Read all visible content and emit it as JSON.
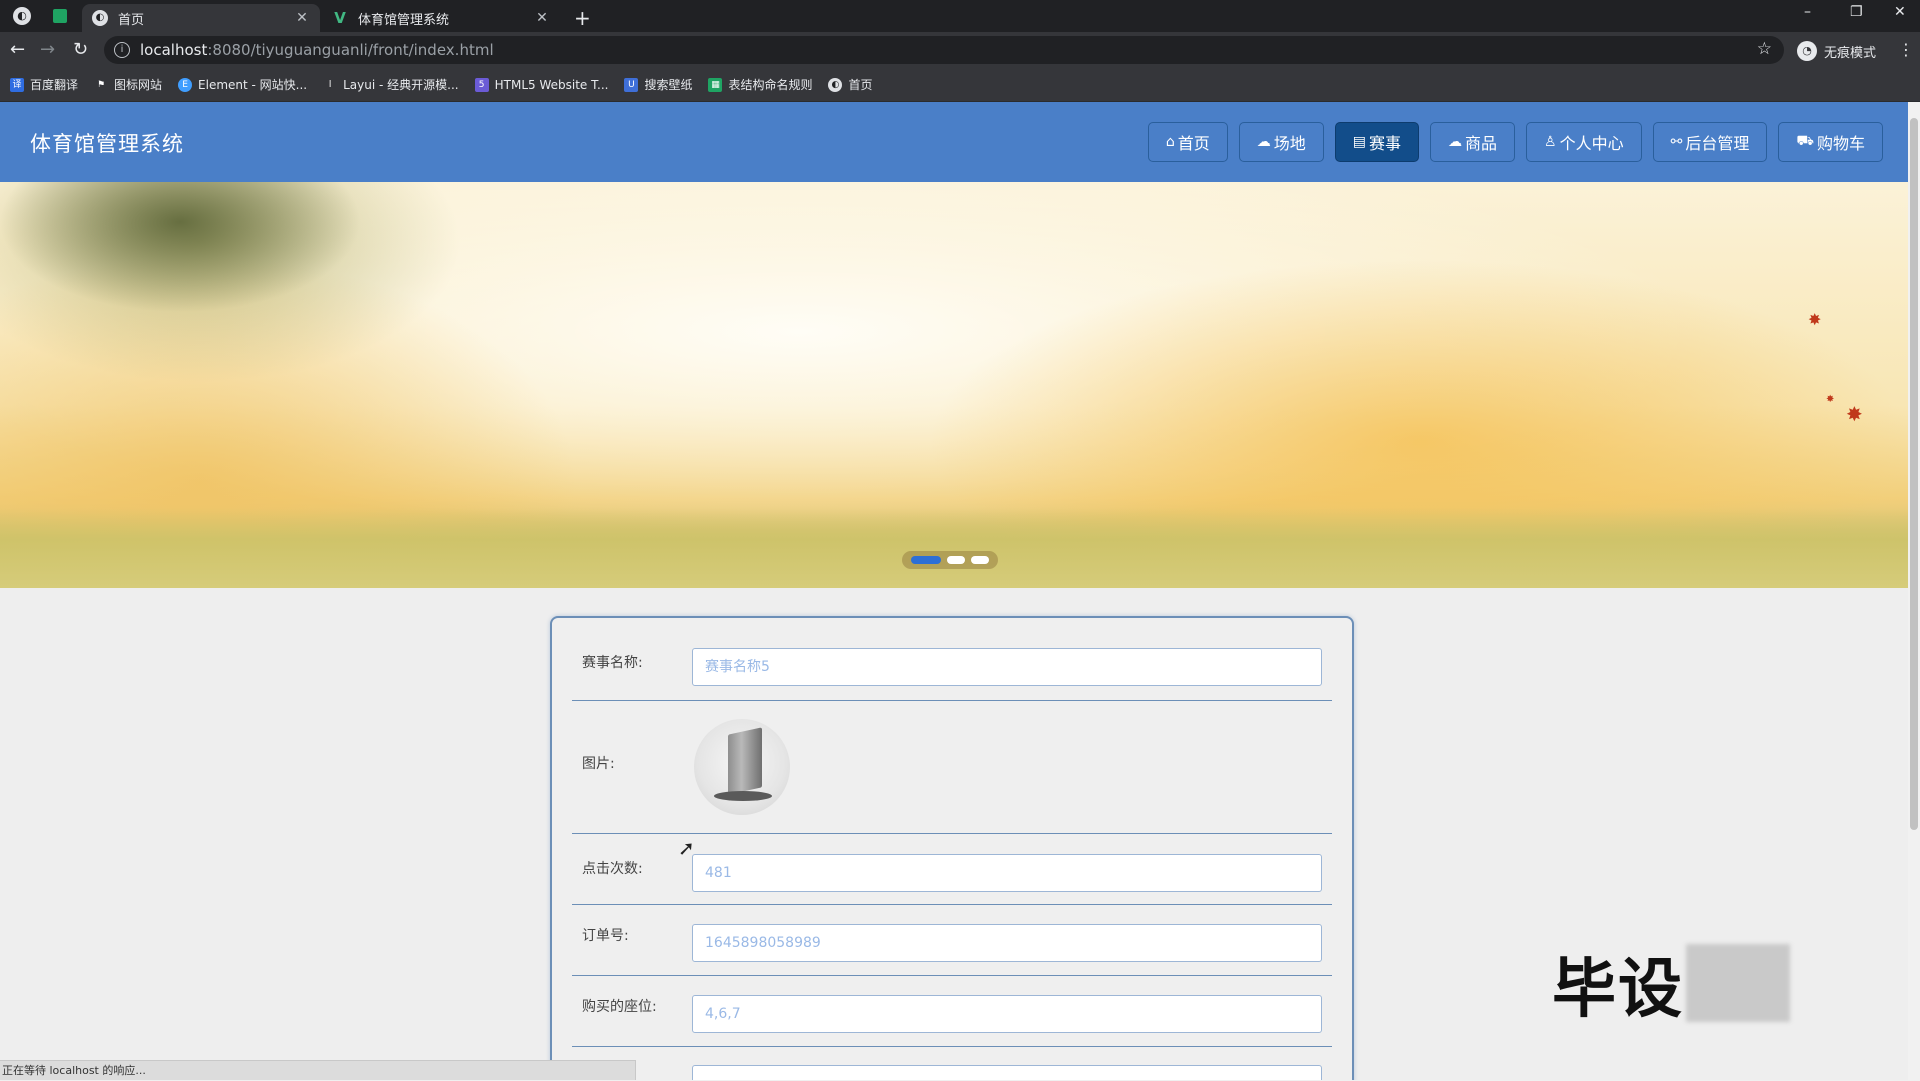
{
  "browser": {
    "tabs": [
      {
        "title": "首页",
        "icon": "globe-icon",
        "active": true
      },
      {
        "title": "体育馆管理系统",
        "icon": "vue-icon",
        "active": false
      }
    ],
    "url_host": "localhost",
    "url_rest": ":8080/tiyuguanguanli/front/index.html",
    "incognito_label": "无痕模式",
    "bookmarks": [
      {
        "label": "百度翻译",
        "icon": "translate-icon",
        "color": "#2f6de1"
      },
      {
        "label": "图标网站",
        "icon": "flag-icon",
        "color": "#444444"
      },
      {
        "label": "Element - 网站快...",
        "icon": "element-icon",
        "color": "#409eff"
      },
      {
        "label": "Layui - 经典开源模...",
        "icon": "layui-icon",
        "color": "#555555"
      },
      {
        "label": "HTML5 Website T...",
        "icon": "html5-icon",
        "color": "#6b5bd6"
      },
      {
        "label": "搜索壁纸",
        "icon": "wallpaper-icon",
        "color": "#3f6fd8"
      },
      {
        "label": "表结构命名规则",
        "icon": "sheet-icon",
        "color": "#1fa463"
      },
      {
        "label": "首页",
        "icon": "globe-icon",
        "color": "#dfe1e5"
      }
    ],
    "status_text": "正在等待 localhost 的响应..."
  },
  "site": {
    "title": "体育馆管理系统",
    "nav": [
      {
        "label": "首页",
        "icon": "home-icon",
        "glyph": "⌂",
        "active": false
      },
      {
        "label": "场地",
        "icon": "venue-icon",
        "glyph": "☁",
        "active": false
      },
      {
        "label": "赛事",
        "icon": "event-icon",
        "glyph": "▤",
        "active": true
      },
      {
        "label": "商品",
        "icon": "goods-icon",
        "glyph": "☁",
        "active": false
      },
      {
        "label": "个人中心",
        "icon": "user-icon",
        "glyph": "♙",
        "active": false
      },
      {
        "label": "后台管理",
        "icon": "link-icon",
        "glyph": "⚯",
        "active": false
      },
      {
        "label": "购物车",
        "icon": "cart-icon",
        "glyph": "⛟",
        "active": false
      }
    ],
    "carousel": {
      "slides": 3,
      "active_index": 0
    }
  },
  "detail": {
    "name_label": "赛事名称:",
    "name_value": "赛事名称5",
    "image_label": "图片:",
    "clicks_label": "点击次数:",
    "clicks_value": "481",
    "order_label": "订单号:",
    "order_value": "1645898058989",
    "seats_label": "购买的座位:",
    "seats_value": "4,6,7"
  },
  "watermark": "毕设"
}
